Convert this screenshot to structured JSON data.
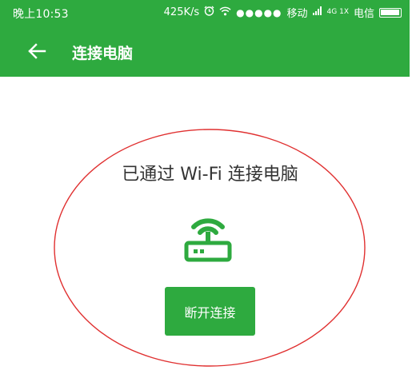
{
  "status_bar": {
    "time": "晚上10:53",
    "speed": "425K/s",
    "alarm_icon": "alarm-clock-icon",
    "wifi_icon": "wifi-icon",
    "signal_dots": "●●●●●",
    "carrier1": "移动",
    "network_small": "4G 1X",
    "carrier2": "电信",
    "battery_icon": "battery-icon"
  },
  "toolbar": {
    "back_icon": "back-arrow-icon",
    "title": "连接电脑"
  },
  "main": {
    "headline": "已通过 Wi-Fi 连接电脑",
    "router_icon": "router-icon",
    "disconnect_label": "断开连接"
  },
  "colors": {
    "accent": "#2eaa3f",
    "annotation": "#e03030"
  }
}
